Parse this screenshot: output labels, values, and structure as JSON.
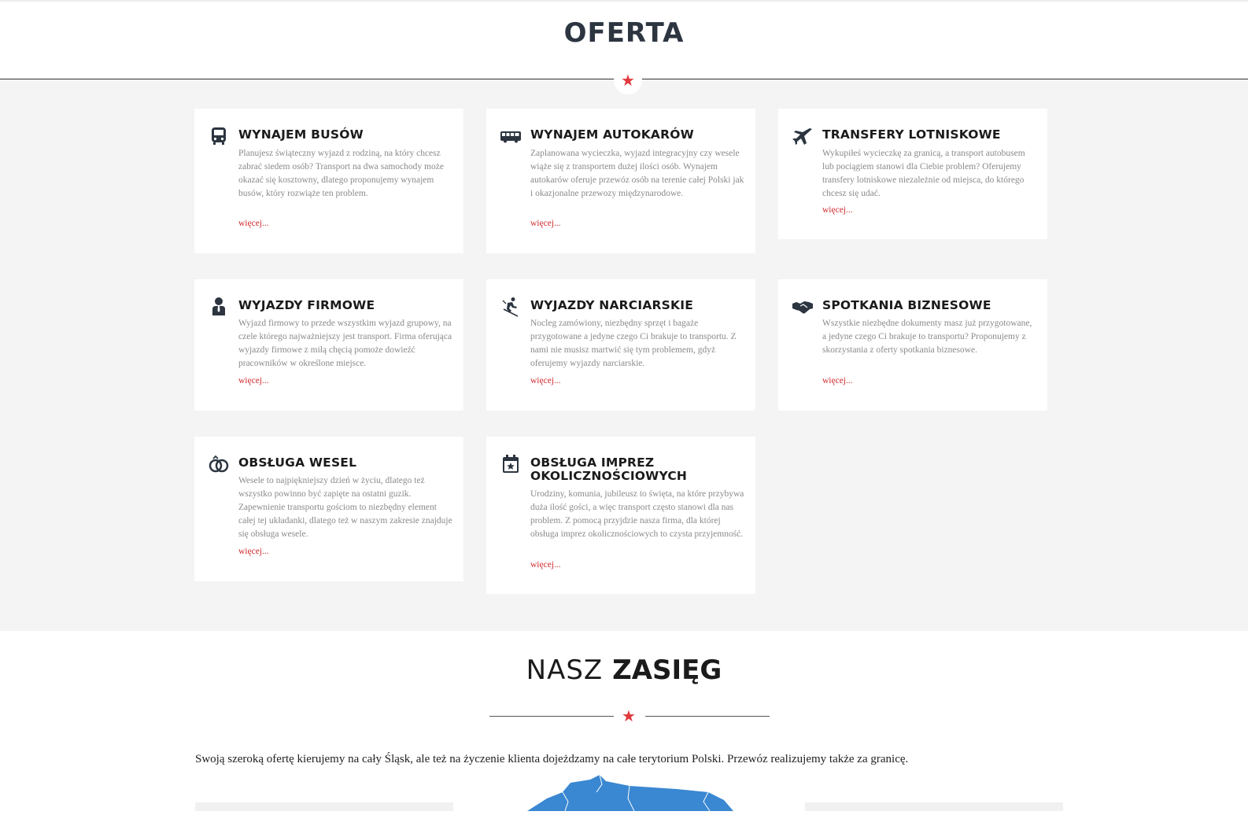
{
  "oferta": {
    "title": "OFERTA",
    "star": "★",
    "accent_color": "#e0393e",
    "cards": [
      {
        "icon": "bus-icon",
        "title": "WYNAJEM BUSÓW",
        "text": "Planujesz świąteczny wyjazd z rodziną, na który chcesz zabrać siedem osób? Transport na dwa samochody może okazać się kosztowny, dlatego proponujemy wynajem busów, który rozwiąże ten problem.",
        "more": "więcej..."
      },
      {
        "icon": "coach-icon",
        "title": "WYNAJEM AUTOKARÓW",
        "text": "Zaplanowana wycieczka, wyjazd integracyjny czy wesele wiąże się z transportem dużej ilości osób. Wynajem autokarów oferuje przewóz osób na terenie całej Polski jak i okazjonalne przewozy międzynarodowe.",
        "more": "więcej..."
      },
      {
        "icon": "airplane-icon",
        "title": "TRANSFERY LOTNISKOWE",
        "text": "Wykupiłeś wycieczkę za granicą, a transport autobusem lub pociągiem stanowi dla Ciebie problem? Oferujemy transfery lotniskowe niezależnie od miejsca, do którego chcesz się udać.",
        "more": "więcej..."
      },
      {
        "icon": "person-icon",
        "title": "WYJAZDY FIRMOWE",
        "text": "Wyjazd firmowy to przede wszystkim wyjazd grupowy, na czele którego najważniejszy jest transport. Firma oferująca wyjazdy firmowe z miłą chęcią pomoże dowieźć pracowników w określone miejsce.",
        "more": "więcej..."
      },
      {
        "icon": "skier-icon",
        "title": "WYJAZDY NARCIARSKIE",
        "text": "Nocleg zamówiony, niezbędny sprzęt i bagaże przygotowane a jedyne czego Ci brakuje to transportu. Z nami nie musisz martwić się tym problemem, gdyż oferujemy wyjazdy narciarskie.",
        "more": "więcej..."
      },
      {
        "icon": "handshake-icon",
        "title": "SPOTKANIA BIZNESOWE",
        "text": "Wszystkie niezbędne dokumenty masz już przygotowane, a jedyne czego Ci brakuje to transportu? Proponujemy z skorzystania z oferty spotkania biznesowe.",
        "more": "więcej..."
      },
      {
        "icon": "rings-icon",
        "title": "OBSŁUGA WESEL",
        "text": "Wesele to najpiękniejszy dzień w życiu, dlatego też wszystko powinno być zapięte na ostatni guzik. Zapewnienie transportu gościom to niezbędny element całej tej układanki, dlatego też w naszym zakresie znajduje się obsługa wesele.",
        "more": "więcej..."
      },
      {
        "icon": "calendar-star-icon",
        "title": "OBSŁUGA IMPREZ OKOLICZNOŚCIOWYCH",
        "text": "Urodziny, komunia, jubileusz to święta, na które przybywa duża ilość gości, a więc transport często stanowi dla nas problem. Z pomocą przyjdzie nasza firma, dla której obsługa imprez okolicznościowych to czysta przyjemność.",
        "more": "więcej..."
      }
    ]
  },
  "zasieg": {
    "title_light": "NASZ",
    "title_bold": "ZASIĘG",
    "star": "★",
    "text": "Swoją szeroką ofertę kierujemy na cały Śląsk, ale też na życzenie klienta dojeżdzamy na całe terytorium Polski. Przewóz realizujemy także za granicę.",
    "map_color": "#3a87d2"
  }
}
